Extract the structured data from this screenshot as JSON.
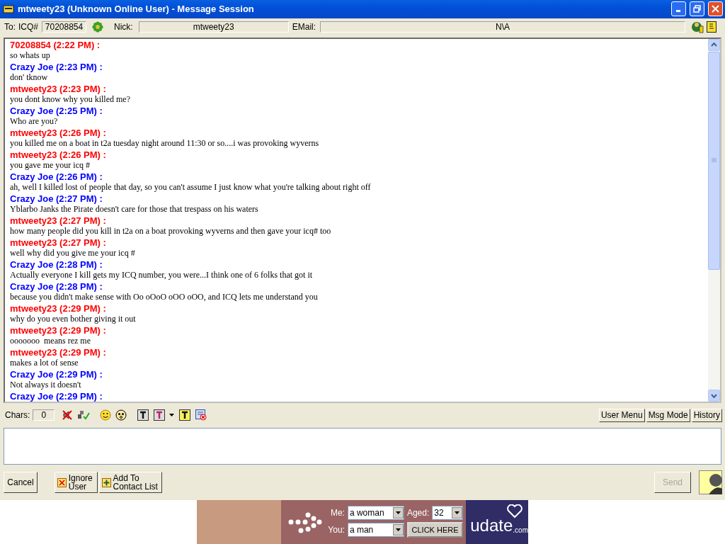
{
  "window": {
    "title": "mtweety23 (Unknown Online User) - Message Session"
  },
  "contact": {
    "to_label": "To:",
    "icq_label": "ICQ#",
    "icq": "70208854",
    "nick_label": "Nick:",
    "nick": "mtweety23",
    "email_label": "EMail:",
    "email": "N\\A"
  },
  "messages": [
    {
      "header": "70208854 (2:22 PM) :",
      "color": "#ff0000",
      "text": "so whats up"
    },
    {
      "header": "Crazy Joe (2:23 PM) :",
      "color": "#0000ff",
      "text": "don' tknow"
    },
    {
      "header": "mtweety23 (2:23 PM) :",
      "color": "#ff0000",
      "text": "you dont know why you killed me?"
    },
    {
      "header": "Crazy Joe (2:25 PM) :",
      "color": "#0000ff",
      "text": "Who are you?"
    },
    {
      "header": "mtweety23 (2:26 PM) :",
      "color": "#ff0000",
      "text": "you killed me on a boat in t2a tuesday night around 11:30 or so....i was provoking wyverns"
    },
    {
      "header": "mtweety23 (2:26 PM) :",
      "color": "#ff0000",
      "text": "you gave me your icq #"
    },
    {
      "header": "Crazy Joe (2:26 PM) :",
      "color": "#0000ff",
      "text": "ah, well I killed lost of people that day, so you can't assume I just know what you're talking about right off"
    },
    {
      "header": "Crazy Joe (2:27 PM) :",
      "color": "#0000ff",
      "text": "Yblarbo Janks the Pirate doesn't care for those that trespass on his waters"
    },
    {
      "header": "mtweety23 (2:27 PM) :",
      "color": "#ff0000",
      "text": "how many people did you kill in t2a on a boat provoking wyverns and then gave your icq# too"
    },
    {
      "header": "mtweety23 (2:27 PM) :",
      "color": "#ff0000",
      "text": "well why did you give me your icq #"
    },
    {
      "header": "Crazy Joe (2:28 PM) :",
      "color": "#0000ff",
      "text": "Actually everyone I kill gets my ICQ number, you were...I think one of 6 folks that got it"
    },
    {
      "header": "Crazy Joe (2:28 PM) :",
      "color": "#0000ff",
      "text": "because you didn't make sense with Oo oOoO oOO oOO, and ICQ lets me understand you"
    },
    {
      "header": "mtweety23 (2:29 PM) :",
      "color": "#ff0000",
      "text": "why do you even bother giving it out"
    },
    {
      "header": "mtweety23 (2:29 PM) :",
      "color": "#ff0000",
      "text": "ooooooo  means rez me"
    },
    {
      "header": "mtweety23 (2:29 PM) :",
      "color": "#ff0000",
      "text": "makes a lot of sense"
    },
    {
      "header": "Crazy Joe (2:29 PM) :",
      "color": "#0000ff",
      "text": "Not always it doesn't"
    },
    {
      "header": "Crazy Joe (2:29 PM) :",
      "color": "#0000ff"
    }
  ],
  "toolbar": {
    "chars_label": "Chars:",
    "chars": "0",
    "buttons": [
      "User Menu",
      "Msg Mode",
      "History"
    ]
  },
  "actions": {
    "cancel": "Cancel",
    "ignore": "Ignore User",
    "add": "Add To Contact List",
    "send": {
      "label": "Send",
      "disabled": true
    }
  },
  "ad": {
    "me_label": "Me:",
    "me": "a woman",
    "aged_label": "Aged:",
    "aged": "32",
    "you_label": "You:",
    "you": "a man",
    "button": "CLICK HERE",
    "brand": "udate",
    "brand_suffix": ".com"
  }
}
